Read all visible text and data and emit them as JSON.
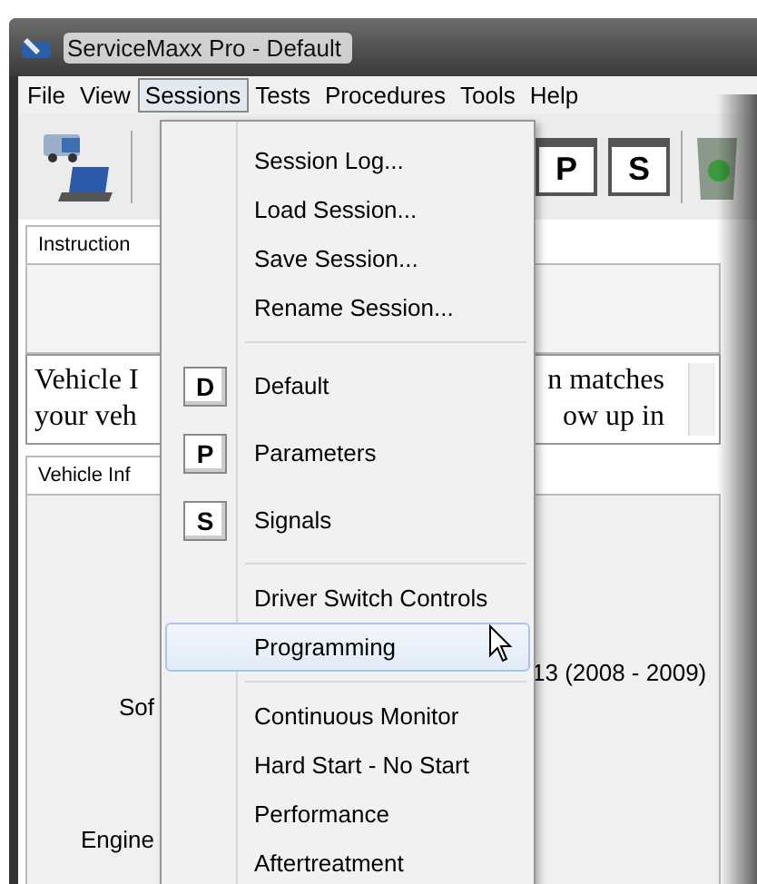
{
  "window": {
    "title": "ServiceMaxx Pro - Default"
  },
  "menu_bar": [
    {
      "label": "File",
      "selected": false
    },
    {
      "label": "View",
      "selected": false
    },
    {
      "label": "Sessions",
      "selected": true
    },
    {
      "label": "Tests",
      "selected": false
    },
    {
      "label": "Procedures",
      "selected": false
    },
    {
      "label": "Tools",
      "selected": false
    },
    {
      "label": "Help",
      "selected": false
    }
  ],
  "toolbar": {
    "window_buttons": [
      "P",
      "S"
    ]
  },
  "instructions": {
    "tab": "Instruction",
    "line_1_start": "Vehicle I",
    "line_1_end": "n matches",
    "line_2_start": "your veh",
    "line_2_end": "ow up in"
  },
  "vehicle_info": {
    "tab": "Vehicle Inf",
    "value": "13 (2008 - 2009)",
    "label_1": "Sof",
    "label_2": "Engine"
  },
  "sessions_menu": [
    {
      "kind": "item",
      "label": "Session Log...",
      "selected": false
    },
    {
      "kind": "item",
      "label": "Load Session...",
      "selected": false
    },
    {
      "kind": "item",
      "label": "Save Session...",
      "selected": false
    },
    {
      "kind": "item",
      "label": "Rename Session...",
      "selected": false
    },
    {
      "kind": "separator"
    },
    {
      "kind": "icon_item",
      "icon": "D",
      "label": "Default",
      "selected": false
    },
    {
      "kind": "icon_item",
      "icon": "P",
      "label": "Parameters",
      "selected": false
    },
    {
      "kind": "icon_item",
      "icon": "S",
      "label": "Signals",
      "selected": false
    },
    {
      "kind": "separator"
    },
    {
      "kind": "item",
      "label": "Driver Switch Controls",
      "selected": false
    },
    {
      "kind": "item",
      "label": "Programming",
      "selected": true
    },
    {
      "kind": "separator"
    },
    {
      "kind": "item",
      "label": "Continuous Monitor",
      "selected": false
    },
    {
      "kind": "item",
      "label": "Hard Start - No Start",
      "selected": false
    },
    {
      "kind": "item",
      "label": "Performance",
      "selected": false
    },
    {
      "kind": "item",
      "label": "Aftertreatment",
      "selected": false
    }
  ]
}
